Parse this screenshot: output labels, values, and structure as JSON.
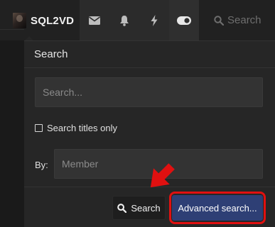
{
  "nav": {
    "username": "SQL2VD",
    "search_label": "Search",
    "icons": [
      "envelope-icon",
      "bell-icon",
      "bolt-icon",
      "toggle-icon",
      "search-icon"
    ]
  },
  "panel": {
    "title": "Search",
    "search_placeholder": "Search...",
    "titles_only_label": "Search titles only",
    "titles_only_checked": false,
    "by_label": "By:",
    "member_placeholder": "Member",
    "search_button": "Search",
    "advanced_button": "Advanced search..."
  },
  "annotation": {
    "highlight_color": "#e01010",
    "target": "advanced-search-button"
  },
  "colors": {
    "accent": "#2e3f75",
    "background": "#1a1a1a",
    "panel": "#262626"
  }
}
